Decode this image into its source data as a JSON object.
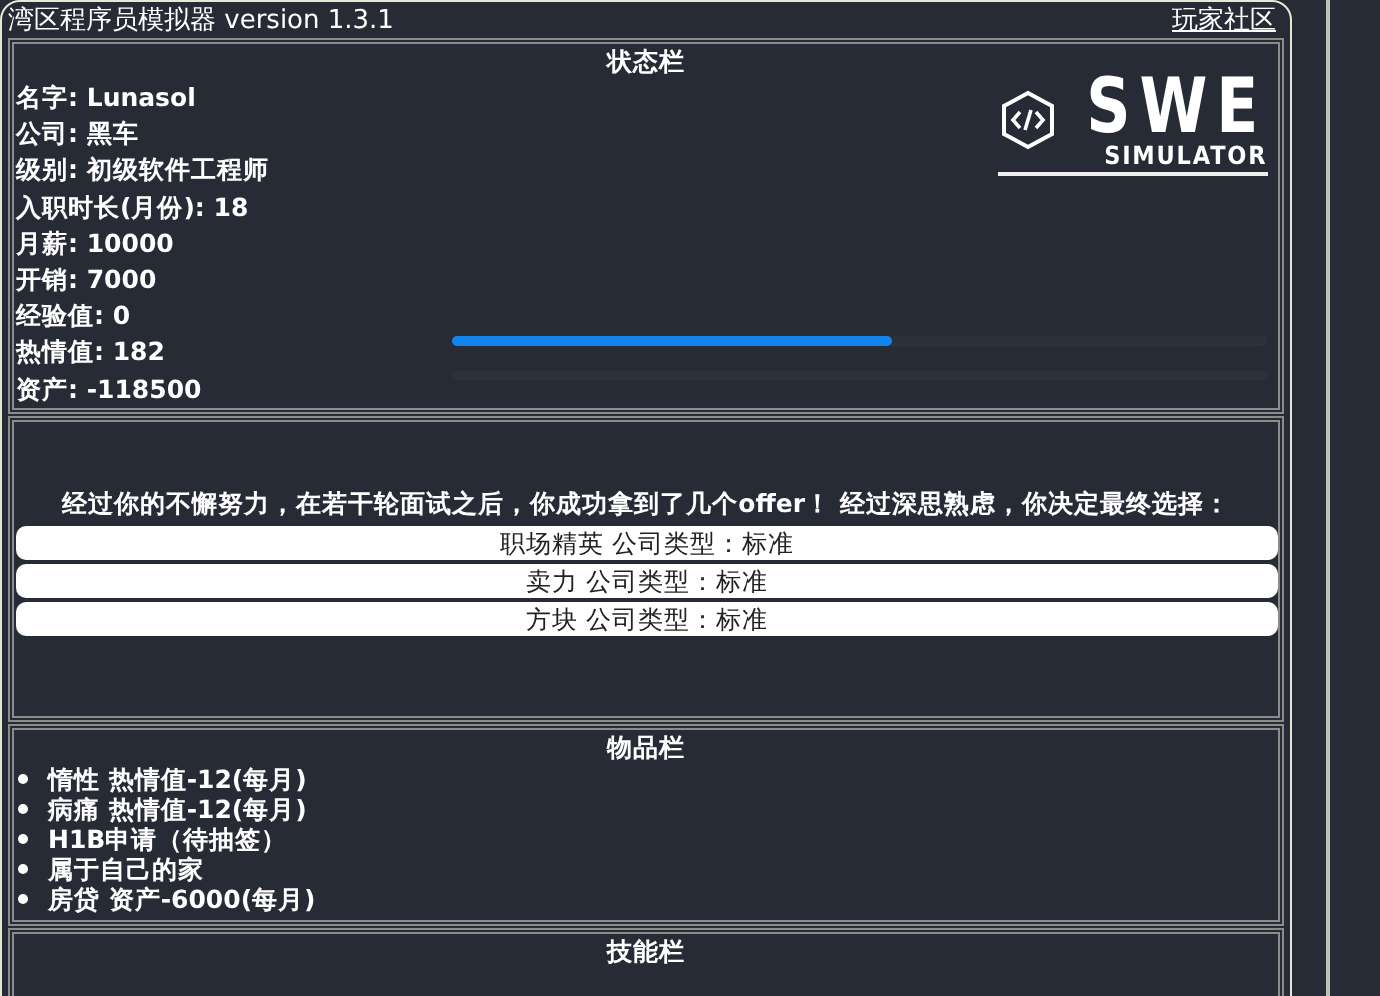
{
  "window": {
    "title": "湾区程序员模拟器 version 1.3.1",
    "link": "玩家社区"
  },
  "status_panel": {
    "heading": "状态栏",
    "logo": {
      "title": "SWE",
      "subtitle": "SIMULATOR"
    },
    "lines": [
      "名字: Lunasol",
      "公司: 黑车",
      "级别: 初级软件工程师",
      "入职时长(月份): 18",
      "月薪: 10000",
      "开销: 7000",
      "经验值: 0",
      "热情值: 182",
      "资产: -118500"
    ],
    "bars": [
      {
        "kind": "meter",
        "level": 0.54
      },
      {
        "kind": "empty"
      }
    ]
  },
  "event_panel": {
    "message": "经过你的不懈努力，在若干轮面试之后，你成功拿到了几个offer！ 经过深思熟虑，你决定最终选择：",
    "choices": [
      "职场精英 公司类型：标准",
      "卖力 公司类型：标准",
      "方块 公司类型：标准"
    ]
  },
  "items_panel": {
    "heading": "物品栏",
    "items": [
      "惰性 热情值-12(每月)",
      "病痛 热情值-12(每月)",
      "H1B申请（待抽签）",
      "属于自己的家",
      "房贷 资产-6000(每月)"
    ]
  },
  "skills_panel": {
    "heading": "技能栏"
  }
}
